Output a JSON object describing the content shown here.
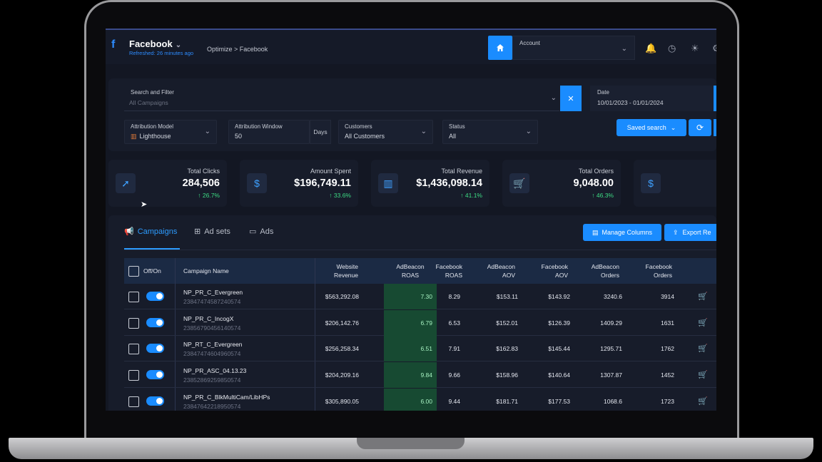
{
  "header": {
    "logo": "f",
    "title": "Facebook",
    "refreshed": "Refreshed: 26 minutes ago",
    "breadcrumb": "Optimize > Facebook",
    "account_label": "Account"
  },
  "filters": {
    "search_label": "Search and Filter",
    "search_placeholder": "All Campaigns",
    "date_label": "Date",
    "date_value": "10/01/2023 - 01/01/2024",
    "attribution_model_label": "Attribution Model",
    "attribution_model_value": "Lighthouse",
    "attribution_window_label": "Attribution Window",
    "attribution_window_value": "50",
    "days_label": "Days",
    "customers_label": "Customers",
    "customers_value": "All Customers",
    "status_label": "Status",
    "status_value": "All",
    "saved_search_label": "Saved search"
  },
  "kpis": [
    {
      "label": "Total Clicks",
      "value": "284,506",
      "change": "↑ 26.7%",
      "icon": "cursor-click-icon"
    },
    {
      "label": "Amount Spent",
      "value": "$196,749.11",
      "change": "↑ 33.6%",
      "icon": "money-hand-icon"
    },
    {
      "label": "Total Revenue",
      "value": "$1,436,098.14",
      "change": "↑ 41.1%",
      "icon": "bar-chart-icon"
    },
    {
      "label": "Total Orders",
      "value": "9,048.00",
      "change": "↑ 46.3%",
      "icon": "cart-icon"
    },
    {
      "label": "",
      "value": "",
      "change": "",
      "icon": "money-bag-icon"
    }
  ],
  "tabs": [
    {
      "label": "Campaigns",
      "active": true
    },
    {
      "label": "Ad sets",
      "active": false
    },
    {
      "label": "Ads",
      "active": false
    }
  ],
  "actions": {
    "manage_columns": "Manage Columns",
    "export": "Export Re"
  },
  "table": {
    "headers": {
      "offon": "Off/On",
      "name": "Campaign Name",
      "website_revenue": [
        "Website",
        "Revenue"
      ],
      "adbeacon_roas": [
        "AdBeacon",
        "ROAS"
      ],
      "facebook_roas": [
        "Facebook",
        "ROAS"
      ],
      "adbeacon_aov": [
        "AdBeacon",
        "AOV"
      ],
      "facebook_aov": [
        "Facebook",
        "AOV"
      ],
      "adbeacon_orders": [
        "AdBeacon",
        "Orders"
      ],
      "facebook_orders": [
        "Facebook",
        "Orders"
      ]
    },
    "rows": [
      {
        "name": "NP_PR_C_Evergreen",
        "id": "23847474587240574",
        "website_revenue": "$563,292.08",
        "adbeacon_roas": "7.30",
        "facebook_roas": "8.29",
        "adbeacon_aov": "$153.11",
        "facebook_aov": "$143.92",
        "adbeacon_orders": "3240.6",
        "facebook_orders": "3914"
      },
      {
        "name": "NP_PR_C_IncogX",
        "id": "23856790456140574",
        "website_revenue": "$206,142.76",
        "adbeacon_roas": "6.79",
        "facebook_roas": "6.53",
        "adbeacon_aov": "$152.01",
        "facebook_aov": "$126.39",
        "adbeacon_orders": "1409.29",
        "facebook_orders": "1631"
      },
      {
        "name": "NP_RT_C_Evergreen",
        "id": "23847474604960574",
        "website_revenue": "$256,258.34",
        "adbeacon_roas": "6.51",
        "facebook_roas": "7.91",
        "adbeacon_aov": "$162.83",
        "facebook_aov": "$145.44",
        "adbeacon_orders": "1295.71",
        "facebook_orders": "1762"
      },
      {
        "name": "NP_PR_ASC_04.13.23",
        "id": "23852869259850574",
        "website_revenue": "$204,209.16",
        "adbeacon_roas": "9.84",
        "facebook_roas": "9.66",
        "adbeacon_aov": "$158.96",
        "facebook_aov": "$140.64",
        "adbeacon_orders": "1307.87",
        "facebook_orders": "1452"
      },
      {
        "name": "NP_PR_C_BlkMultiCam/LibHPs",
        "id": "23847642218950574",
        "website_revenue": "$305,890.05",
        "adbeacon_roas": "6.00",
        "facebook_roas": "9.44",
        "adbeacon_aov": "$181.71",
        "facebook_aov": "$177.53",
        "adbeacon_orders": "1068.6",
        "facebook_orders": "1723"
      }
    ]
  },
  "colors": {
    "accent": "#1a8cff",
    "positive": "#3ddc84",
    "background": "#131723",
    "roas_highlight": "#174a32"
  }
}
